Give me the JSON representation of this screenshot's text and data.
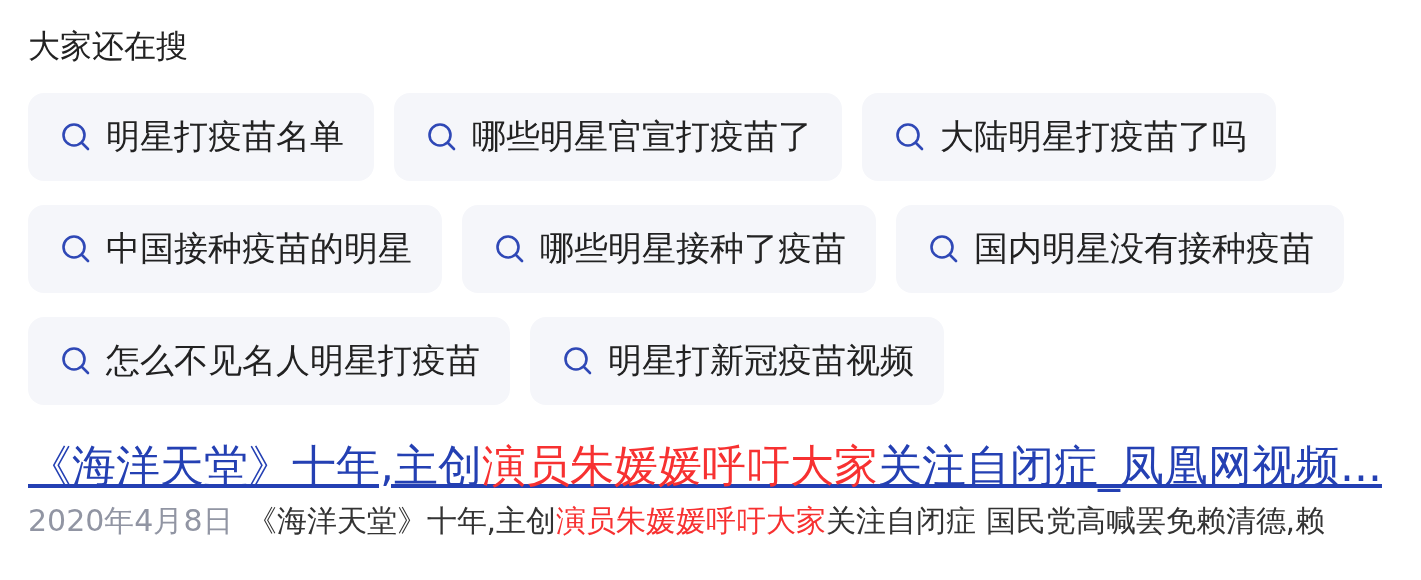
{
  "heading": "大家还在搜",
  "suggestions": [
    [
      "明星打疫苗名单",
      "哪些明星官宣打疫苗了",
      "大陆明星打疫苗了吗"
    ],
    [
      "中国接种疫苗的明星",
      "哪些明星接种了疫苗",
      "国内明星没有接种疫苗"
    ],
    [
      "怎么不见名人明星打疫苗",
      "明星打新冠疫苗视频"
    ]
  ],
  "result": {
    "title": [
      {
        "text": "《海洋天堂》十年,主创",
        "highlight": false
      },
      {
        "text": "演员朱媛媛呼吁大家",
        "highlight": true
      },
      {
        "text": "关注自闭症_凤凰网视频...",
        "highlight": false
      }
    ],
    "date": "2020年4月8日",
    "snippet": [
      {
        "text": "《海洋天堂》十年,主创",
        "highlight": false
      },
      {
        "text": "演员朱媛媛呼吁大家",
        "highlight": true
      },
      {
        "text": "关注自闭症 国民党高喊罢免赖清德,赖",
        "highlight": false
      }
    ]
  }
}
